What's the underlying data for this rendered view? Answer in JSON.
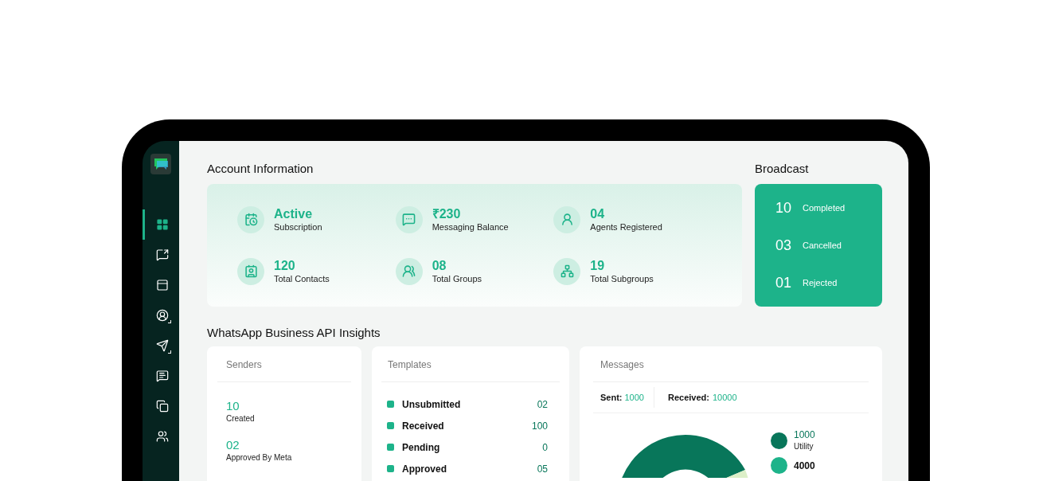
{
  "sidebar": {
    "items": [
      {
        "selected": true,
        "submenu": false
      },
      {
        "selected": false,
        "submenu": false
      },
      {
        "selected": false,
        "submenu": false
      },
      {
        "selected": false,
        "submenu": true
      },
      {
        "selected": false,
        "submenu": true
      },
      {
        "selected": false,
        "submenu": false
      },
      {
        "selected": false,
        "submenu": false
      },
      {
        "selected": false,
        "submenu": false
      }
    ]
  },
  "account": {
    "title": "Account Information",
    "stats": [
      {
        "value": "Active",
        "label": "Subscription"
      },
      {
        "value": "₹230",
        "label": "Messaging Balance"
      },
      {
        "value": "04",
        "label": "Agents Registered"
      },
      {
        "value": "120",
        "label": "Total Contacts"
      },
      {
        "value": "08",
        "label": "Total Groups"
      },
      {
        "value": "19",
        "label": "Total Subgroups"
      }
    ]
  },
  "broadcast": {
    "title": "Broadcast",
    "items": [
      {
        "value": "10",
        "label": "Completed"
      },
      {
        "value": "03",
        "label": "Cancelled"
      },
      {
        "value": "01",
        "label": "Rejected"
      }
    ]
  },
  "insights": {
    "title": "WhatsApp Business API Insights",
    "senders": {
      "title": "Senders",
      "items": [
        {
          "value": "10",
          "label": "Created"
        },
        {
          "value": "02",
          "label": "Approved By Meta"
        }
      ]
    },
    "templates": {
      "title": "Templates",
      "rows": [
        {
          "label": "Unsubmitted",
          "value": "02"
        },
        {
          "label": "Received",
          "value": "100"
        },
        {
          "label": "Pending",
          "value": "0"
        },
        {
          "label": "Approved",
          "value": "05"
        }
      ]
    },
    "messages": {
      "title": "Messages",
      "sent_label": "Sent:",
      "sent": "1000",
      "received_label": "Received:",
      "received": "10000",
      "legend": [
        {
          "value": "1000",
          "label": "Utility",
          "color": "#08765a"
        },
        {
          "value": "4000",
          "color": "#1db38a"
        }
      ]
    }
  }
}
